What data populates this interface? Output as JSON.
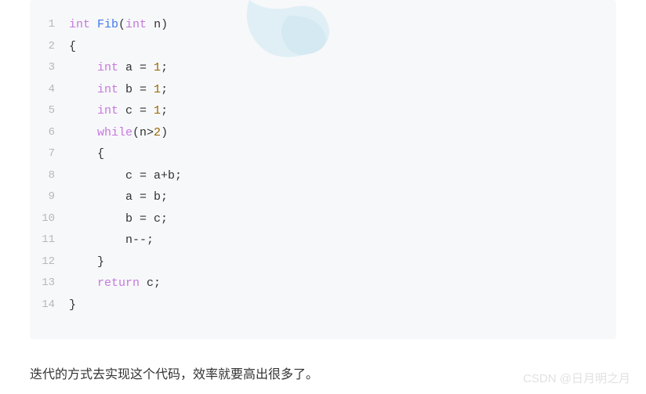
{
  "code": {
    "lines": [
      {
        "num": "1",
        "indent": "",
        "tokens": [
          {
            "t": "int ",
            "c": "kw-type"
          },
          {
            "t": "Fib",
            "c": "kw-func"
          },
          {
            "t": "(",
            "c": ""
          },
          {
            "t": "int ",
            "c": "kw-type"
          },
          {
            "t": "n)",
            "c": ""
          }
        ]
      },
      {
        "num": "2",
        "indent": "",
        "tokens": [
          {
            "t": "{",
            "c": ""
          }
        ]
      },
      {
        "num": "3",
        "indent": "    ",
        "tokens": [
          {
            "t": "int ",
            "c": "kw-type"
          },
          {
            "t": "a = ",
            "c": ""
          },
          {
            "t": "1",
            "c": "kw-num"
          },
          {
            "t": ";",
            "c": ""
          }
        ]
      },
      {
        "num": "4",
        "indent": "    ",
        "tokens": [
          {
            "t": "int ",
            "c": "kw-type"
          },
          {
            "t": "b = ",
            "c": ""
          },
          {
            "t": "1",
            "c": "kw-num"
          },
          {
            "t": ";",
            "c": ""
          }
        ]
      },
      {
        "num": "5",
        "indent": "    ",
        "tokens": [
          {
            "t": "int ",
            "c": "kw-type"
          },
          {
            "t": "c = ",
            "c": ""
          },
          {
            "t": "1",
            "c": "kw-num"
          },
          {
            "t": ";",
            "c": ""
          }
        ]
      },
      {
        "num": "6",
        "indent": "    ",
        "tokens": [
          {
            "t": "while",
            "c": "kw-keyword"
          },
          {
            "t": "(n>",
            "c": ""
          },
          {
            "t": "2",
            "c": "kw-num"
          },
          {
            "t": ")",
            "c": ""
          }
        ]
      },
      {
        "num": "7",
        "indent": "    ",
        "tokens": [
          {
            "t": "{",
            "c": ""
          }
        ]
      },
      {
        "num": "8",
        "indent": "        ",
        "tokens": [
          {
            "t": "c = a+b;",
            "c": ""
          }
        ]
      },
      {
        "num": "9",
        "indent": "        ",
        "tokens": [
          {
            "t": "a = b;",
            "c": ""
          }
        ]
      },
      {
        "num": "10",
        "indent": "        ",
        "tokens": [
          {
            "t": "b = c;",
            "c": ""
          }
        ]
      },
      {
        "num": "11",
        "indent": "        ",
        "tokens": [
          {
            "t": "n--;",
            "c": ""
          }
        ]
      },
      {
        "num": "12",
        "indent": "    ",
        "tokens": [
          {
            "t": "}",
            "c": ""
          }
        ]
      },
      {
        "num": "13",
        "indent": "    ",
        "tokens": [
          {
            "t": "return ",
            "c": "kw-return"
          },
          {
            "t": "c;",
            "c": ""
          }
        ]
      },
      {
        "num": "14",
        "indent": "",
        "tokens": [
          {
            "t": "}",
            "c": ""
          }
        ]
      }
    ]
  },
  "description": "迭代的方式去实现这个代码，效率就要高出很多了。",
  "attribution": "CSDN @日月明之月"
}
